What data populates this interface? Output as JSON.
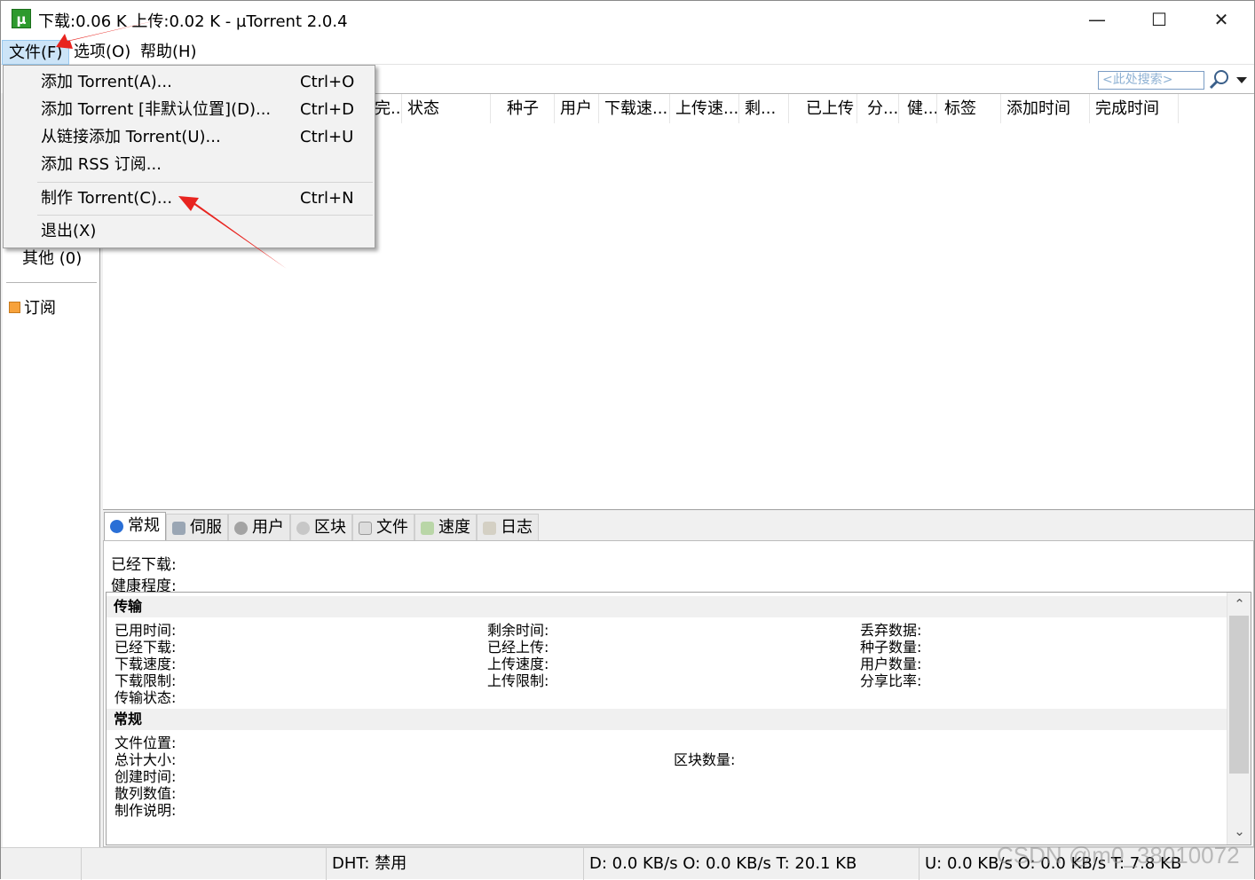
{
  "window": {
    "title": "下载:0.06 K 上传:0.02 K - µTorrent 2.0.4",
    "app_icon_glyph": "µ",
    "minimize_glyph": "—",
    "maximize_glyph": "☐",
    "close_glyph": "✕"
  },
  "menu": {
    "file": "文件(F)",
    "options": "选项(O)",
    "help": "帮助(H)"
  },
  "file_menu": [
    {
      "label": "添加 Torrent(A)...",
      "shortcut": "Ctrl+O"
    },
    {
      "label": "添加 Torrent [非默认位置](D)...",
      "shortcut": "Ctrl+D"
    },
    {
      "label": "从链接添加 Torrent(U)...",
      "shortcut": "Ctrl+U"
    },
    {
      "label": "添加 RSS 订阅...",
      "shortcut": ""
    },
    {
      "label": "制作 Torrent(C)...",
      "shortcut": "Ctrl+N"
    },
    {
      "label": "退出(X)",
      "shortcut": ""
    }
  ],
  "search": {
    "placeholder": "<此处搜索>"
  },
  "sidebar": {
    "other": "其他 (0)",
    "feeds": "订阅"
  },
  "columns": [
    "完...",
    "状态",
    "种子",
    "用户",
    "下载速...",
    "上传速...",
    "剩...",
    "已上传",
    "分...",
    "健...",
    "标签",
    "添加时间",
    "完成时间"
  ],
  "tabs": [
    {
      "label": "常规",
      "icon": "info-icon",
      "color": "#2a6fd6"
    },
    {
      "label": "伺服",
      "icon": "tracker-icon",
      "color": "#8a8a8a"
    },
    {
      "label": "用户",
      "icon": "peers-icon",
      "color": "#8a8a8a"
    },
    {
      "label": "区块",
      "icon": "pieces-icon",
      "color": "#8a8a8a"
    },
    {
      "label": "文件",
      "icon": "files-icon",
      "color": "#8a8a8a"
    },
    {
      "label": "速度",
      "icon": "speed-icon",
      "color": "#6aa84f"
    },
    {
      "label": "日志",
      "icon": "logger-icon",
      "color": "#8a8a8a"
    }
  ],
  "summary": {
    "downloaded": "已经下载:",
    "availability": "健康程度:"
  },
  "transfer": {
    "heading": "传输",
    "col1": [
      "已用时间:",
      "已经下载:",
      "下载速度:",
      "下载限制:",
      "传输状态:"
    ],
    "col2": [
      "剩余时间:",
      "已经上传:",
      "上传速度:",
      "上传限制:"
    ],
    "col3": [
      "丢弃数据:",
      "种子数量:",
      "用户数量:",
      "分享比率:"
    ]
  },
  "general": {
    "heading": "常规",
    "col1": [
      "文件位置:",
      "总计大小:",
      "创建时间:",
      "散列数值:",
      "制作说明:"
    ],
    "pieces": "区块数量:"
  },
  "status": {
    "dht": "DHT: 禁用",
    "download": "D: 0.0 KB/s O: 0.0 KB/s T: 20.1 KB",
    "upload": "U: 0.0 KB/s O: 0.0 KB/s T: 7.8 KB"
  },
  "watermark": "CSDN @m0_38010072",
  "colors": {
    "annotation_arrow": "#e8241f",
    "menu_highlight": "#cce4f7",
    "app_icon": "#2e9a2e"
  }
}
